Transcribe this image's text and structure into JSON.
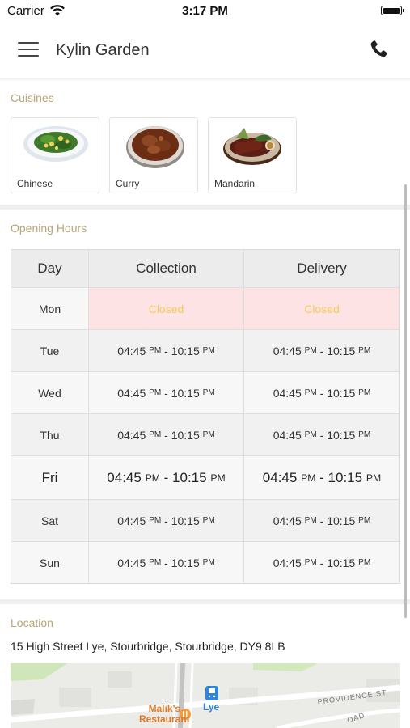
{
  "status_bar": {
    "carrier": "Carrier",
    "time": "3:17 PM"
  },
  "nav": {
    "title": "Kylin Garden",
    "menu_icon": "hamburger-menu-icon",
    "call_icon": "phone-icon"
  },
  "cuisines": {
    "label": "Cuisines",
    "items": [
      {
        "name": "Chinese",
        "image": "chinese-dish-image"
      },
      {
        "name": "Curry",
        "image": "curry-dish-image"
      },
      {
        "name": "Mandarin",
        "image": "mandarin-dish-image"
      }
    ]
  },
  "opening_hours": {
    "label": "Opening Hours",
    "headers": {
      "day": "Day",
      "collection": "Collection",
      "delivery": "Delivery"
    },
    "closed_text": "Closed",
    "rows": [
      {
        "day": "Mon",
        "closed": true
      },
      {
        "day": "Tue",
        "open": "04:45",
        "close": "10:15",
        "ampm_open": "PM",
        "ampm_close": "PM"
      },
      {
        "day": "Wed",
        "open": "04:45",
        "close": "10:15",
        "ampm_open": "PM",
        "ampm_close": "PM"
      },
      {
        "day": "Thu",
        "open": "04:45",
        "close": "10:15",
        "ampm_open": "PM",
        "ampm_close": "PM"
      },
      {
        "day": "Fri",
        "open": "04:45",
        "close": "10:15",
        "ampm_open": "PM",
        "ampm_close": "PM",
        "today": true
      },
      {
        "day": "Sat",
        "open": "04:45",
        "close": "10:15",
        "ampm_open": "PM",
        "ampm_close": "PM"
      },
      {
        "day": "Sun",
        "open": "04:45",
        "close": "10:15",
        "ampm_open": "PM",
        "ampm_close": "PM"
      }
    ],
    "separator": " - "
  },
  "location": {
    "label": "Location",
    "address": "15 High Street Lye, Stourbridge, Stourbridge, DY9 8LB",
    "map": {
      "poi_restaurant": "Malik's Restaurant",
      "poi_restaurant_line1": "Malik's",
      "poi_restaurant_line2": "Restaurant",
      "poi_station": "Lye",
      "street": "PROVIDENCE ST",
      "road_fragment": "OAD"
    }
  },
  "colors": {
    "accent_label": "#b9a577",
    "closed_bg": "#fde3e3",
    "closed_text": "#f4cd5a"
  }
}
